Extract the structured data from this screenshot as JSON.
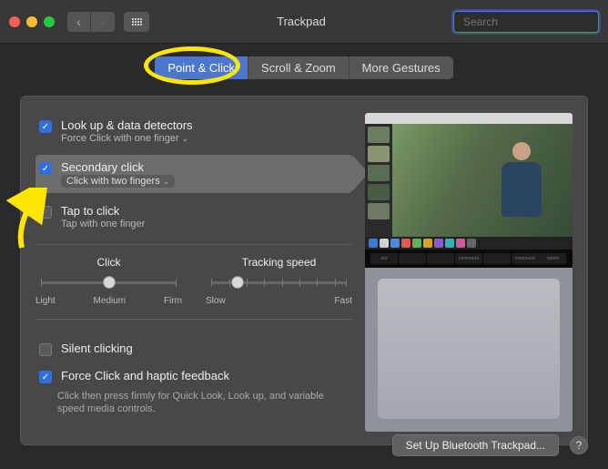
{
  "window": {
    "title": "Trackpad",
    "search_placeholder": "Search"
  },
  "tabs": [
    {
      "label": "Point & Click",
      "active": true
    },
    {
      "label": "Scroll & Zoom",
      "active": false
    },
    {
      "label": "More Gestures",
      "active": false
    }
  ],
  "options": {
    "lookup": {
      "title": "Look up & data detectors",
      "subtitle": "Force Click with one finger",
      "checked": true,
      "has_submenu": true
    },
    "secondary": {
      "title": "Secondary click",
      "subtitle": "Click with two fingers",
      "checked": true,
      "has_submenu": true,
      "selected": true
    },
    "tap": {
      "title": "Tap to click",
      "subtitle": "Tap with one finger",
      "checked": false
    }
  },
  "sliders": {
    "click": {
      "label": "Click",
      "min_label": "Light",
      "mid_label": "Medium",
      "max_label": "Firm",
      "value_pct": 50
    },
    "tracking": {
      "label": "Tracking speed",
      "min_label": "Slow",
      "max_label": "Fast",
      "value_pct": 22
    }
  },
  "bottom_options": {
    "silent": {
      "title": "Silent clicking",
      "checked": false
    },
    "force": {
      "title": "Force Click and haptic feedback",
      "description": "Click then press firmly for Quick Look, Look up, and variable speed media controls.",
      "checked": true
    }
  },
  "footer": {
    "setup_label": "Set Up Bluetooth Trackpad...",
    "help_label": "?"
  },
  "annotation": {
    "highlight_tab": "Point & Click",
    "arrow_target": "secondary-click-checkbox"
  },
  "colors": {
    "accent": "#2f6fe0",
    "highlight": "#ffe600"
  }
}
